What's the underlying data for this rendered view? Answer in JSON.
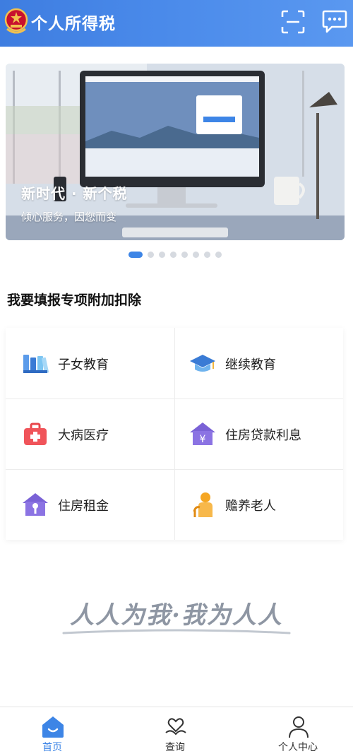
{
  "header": {
    "title": "个人所得税",
    "emblem_icon": "national-emblem-icon",
    "scan_icon": "scan-icon",
    "message_icon": "message-icon",
    "background_color": "#4a8aea"
  },
  "banner": {
    "title": "新时代 · 新个税",
    "subtitle": "倾心服务，因您而变",
    "slide_count": 8,
    "active_slide": 1,
    "accent_color": "#3d85e6"
  },
  "deduction": {
    "section_title": "我要填报专项附加扣除",
    "items": [
      {
        "label": "子女教育",
        "icon": "books-icon"
      },
      {
        "label": "继续教育",
        "icon": "graduation-cap-icon"
      },
      {
        "label": "大病医疗",
        "icon": "medical-kit-icon"
      },
      {
        "label": "住房贷款利息",
        "icon": "house-loan-icon"
      },
      {
        "label": "住房租金",
        "icon": "house-key-icon"
      },
      {
        "label": "赡养老人",
        "icon": "elderly-icon"
      }
    ]
  },
  "slogan": {
    "text": "人人为我·我为人人"
  },
  "tabbar": {
    "active_color": "#3d85e6",
    "items": [
      {
        "label": "首页",
        "icon": "home-icon",
        "active": true
      },
      {
        "label": "查询",
        "icon": "heart-hand-icon",
        "active": false
      },
      {
        "label": "个人中心",
        "icon": "user-icon",
        "active": false
      }
    ]
  }
}
